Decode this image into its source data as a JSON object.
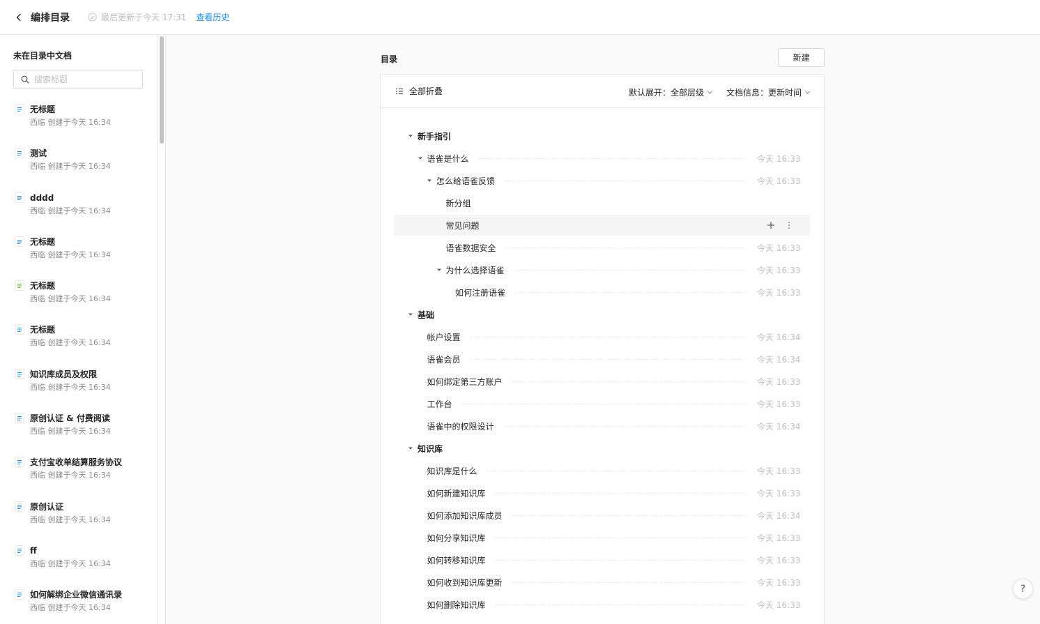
{
  "header": {
    "title": "编排目录",
    "update_info": "最后更新于今天 17:31",
    "history_link": "查看历史"
  },
  "sidebar": {
    "title": "未在目录中文档",
    "search_placeholder": "搜索标题",
    "docs": [
      {
        "title": "无标题",
        "meta": "西临 创建于今天 16:34",
        "icon": "doc-icon"
      },
      {
        "title": "测试",
        "meta": "西临 创建于今天 16:34",
        "icon": "doc-icon"
      },
      {
        "title": "dddd",
        "meta": "西临 创建于今天 16:34",
        "icon": "doc-icon"
      },
      {
        "title": "无标题",
        "meta": "西临 创建于今天 16:34",
        "icon": "doc-icon"
      },
      {
        "title": "无标题",
        "meta": "西临 创建于今天 16:34",
        "icon": "sheet-icon"
      },
      {
        "title": "无标题",
        "meta": "西临 创建于今天 16:34",
        "icon": "doc-icon"
      },
      {
        "title": "知识库成员及权限",
        "meta": "西临 创建于今天 16:34",
        "icon": "doc-icon"
      },
      {
        "title": "原创认证 & 付费阅读",
        "meta": "西临 创建于今天 16:34",
        "icon": "doc-icon"
      },
      {
        "title": "支付宝收单结算服务协议",
        "meta": "西临 创建于今天 16:34",
        "icon": "doc-icon"
      },
      {
        "title": "原创认证",
        "meta": "西临 创建于今天 16:34",
        "icon": "doc-icon"
      },
      {
        "title": "ff",
        "meta": "西临 创建于今天 16:34",
        "icon": "doc-icon"
      },
      {
        "title": "如何解绑企业微信通讯录",
        "meta": "西临 创建于今天 16:34",
        "icon": "doc-icon"
      }
    ]
  },
  "main": {
    "toc_label": "目录",
    "new_button": "新建",
    "toolbar": {
      "collapse_all": "全部折叠",
      "default_expand": "默认展开：全部层级",
      "doc_info": "文档信息：更新时间"
    },
    "tree": [
      {
        "label": "新手指引",
        "level": 0,
        "caret": true,
        "bold": true,
        "time": ""
      },
      {
        "label": "语雀是什么",
        "level": 1,
        "caret": true,
        "bold": false,
        "time": "今天 16:33"
      },
      {
        "label": "怎么给语雀反馈",
        "level": 2,
        "caret": true,
        "bold": false,
        "time": "今天 16:33"
      },
      {
        "label": "新分组",
        "level": 3,
        "caret": false,
        "bold": false,
        "time": ""
      },
      {
        "label": "常见问题",
        "level": 3,
        "caret": false,
        "bold": false,
        "time": "",
        "hovered": true
      },
      {
        "label": "语雀数据安全",
        "level": 3,
        "caret": false,
        "bold": false,
        "time": "今天 16:33"
      },
      {
        "label": "为什么选择语雀",
        "level": 3,
        "caret": true,
        "bold": false,
        "time": "今天 16:33"
      },
      {
        "label": "如何注册语雀",
        "level": 4,
        "caret": false,
        "bold": false,
        "time": "今天 16:33"
      },
      {
        "label": "基础",
        "level": 0,
        "caret": true,
        "bold": true,
        "time": ""
      },
      {
        "label": "帐户设置",
        "level": 1,
        "caret": false,
        "bold": false,
        "time": "今天 16:34"
      },
      {
        "label": "语雀会员",
        "level": 1,
        "caret": false,
        "bold": false,
        "time": "今天 16:34"
      },
      {
        "label": "如何绑定第三方账户",
        "level": 1,
        "caret": false,
        "bold": false,
        "time": "今天 16:33"
      },
      {
        "label": "工作台",
        "level": 1,
        "caret": false,
        "bold": false,
        "time": "今天 16:33"
      },
      {
        "label": "语雀中的权限设计",
        "level": 1,
        "caret": false,
        "bold": false,
        "time": "今天 16:34"
      },
      {
        "label": "知识库",
        "level": 0,
        "caret": true,
        "bold": true,
        "time": ""
      },
      {
        "label": "知识库是什么",
        "level": 1,
        "caret": false,
        "bold": false,
        "time": "今天 16:33"
      },
      {
        "label": "如何新建知识库",
        "level": 1,
        "caret": false,
        "bold": false,
        "time": "今天 16:33"
      },
      {
        "label": "如何添加知识库成员",
        "level": 1,
        "caret": false,
        "bold": false,
        "time": "今天 16:34"
      },
      {
        "label": "如何分享知识库",
        "level": 1,
        "caret": false,
        "bold": false,
        "time": "今天 16:33"
      },
      {
        "label": "如何转移知识库",
        "level": 1,
        "caret": false,
        "bold": false,
        "time": "今天 16:33"
      },
      {
        "label": "如何收到知识库更新",
        "level": 1,
        "caret": false,
        "bold": false,
        "time": "今天 16:33"
      },
      {
        "label": "如何删除知识库",
        "level": 1,
        "caret": false,
        "bold": false,
        "time": "今天 16:33"
      }
    ]
  },
  "help": "?",
  "colors": {
    "accent": "#1890ff",
    "doc_icon": "#1890ff",
    "sheet_icon": "#52c41a",
    "muted": "#bfbfbf"
  }
}
